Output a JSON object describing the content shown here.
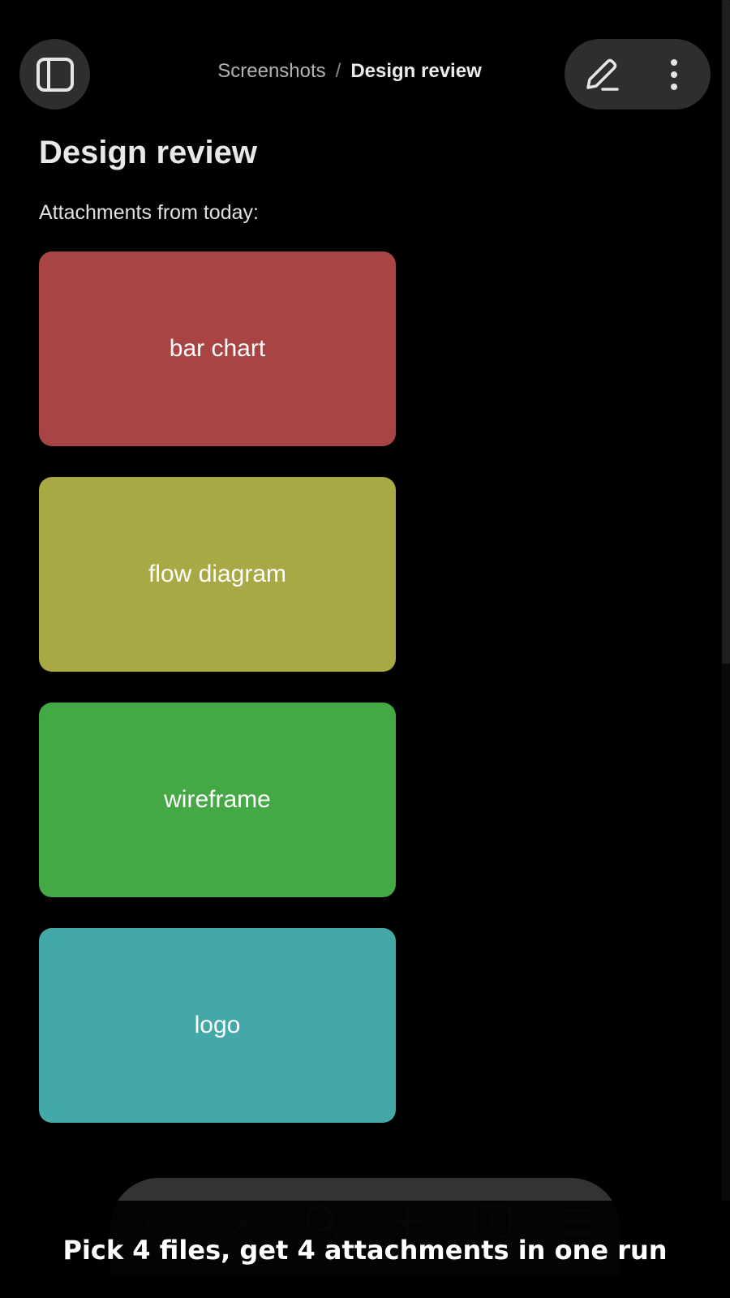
{
  "header": {
    "breadcrumb_parent": "Screenshots",
    "breadcrumb_separator": "/",
    "breadcrumb_current": "Design review",
    "sidebar_icon": "sidebar-toggle-icon",
    "edit_icon": "pencil-icon",
    "more_icon": "more-vertical-icon"
  },
  "main": {
    "title": "Design review",
    "intro": "Attachments from today:",
    "attachments": [
      {
        "label": "bar chart",
        "color": "#a84444"
      },
      {
        "label": "flow diagram",
        "color": "#a8a844"
      },
      {
        "label": "wireframe",
        "color": "#44a844"
      },
      {
        "label": "logo",
        "color": "#44a8a8"
      }
    ]
  },
  "toolbar": {
    "icons": [
      "back-icon",
      "forward-icon",
      "search-icon",
      "add-icon",
      "tabs-icon",
      "menu-icon"
    ],
    "tab_count": "1"
  },
  "caption": "Pick 4 files, get 4 attachments in one run",
  "colors": {
    "background": "#000000",
    "button_bg": "#2e2e2e"
  }
}
